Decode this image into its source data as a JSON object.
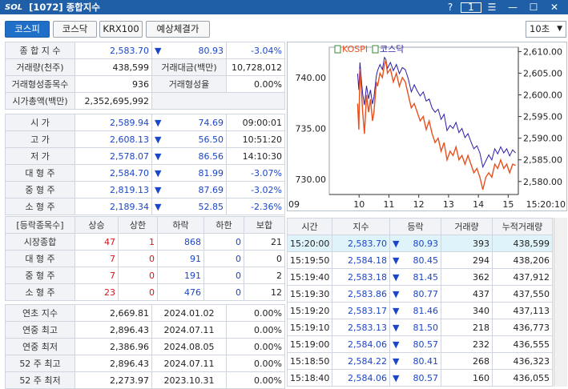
{
  "window": {
    "logo": "SOL",
    "title": "[1072] 종합지수",
    "help": "?",
    "num_box": "1"
  },
  "tabs": [
    "코스피",
    "코스닥",
    "KRX100",
    "예상체결가"
  ],
  "interval": "10초",
  "summary": [
    [
      "종 합 지 수",
      "2,583.70",
      "▼",
      "80.93",
      "-3.04%"
    ],
    [
      "거래량(천주)",
      "438,599",
      "거래대금(백만)",
      "10,728,012"
    ],
    [
      "거래형성종목수",
      "936",
      "거래형성율",
      "0.00%"
    ],
    [
      "시가총액(백만)",
      "2,352,695,992"
    ]
  ],
  "ohlc": [
    {
      "label": "시 가",
      "value": "2,589.94",
      "arrow": "▼",
      "diff": "74.69",
      "extra": "09:00:01"
    },
    {
      "label": "고 가",
      "value": "2,608.13",
      "arrow": "▼",
      "diff": "56.50",
      "extra": "10:51:20"
    },
    {
      "label": "저 가",
      "value": "2,578.07",
      "arrow": "▼",
      "diff": "86.56",
      "extra": "14:10:30"
    },
    {
      "label": "대 형 주",
      "value": "2,584.70",
      "arrow": "▼",
      "diff": "81.99",
      "extra": "-3.07%"
    },
    {
      "label": "중 형 주",
      "value": "2,819.13",
      "arrow": "▼",
      "diff": "87.69",
      "extra": "-3.02%"
    },
    {
      "label": "소 형 주",
      "value": "2,189.34",
      "arrow": "▼",
      "diff": "52.85",
      "extra": "-2.36%"
    }
  ],
  "breadth": {
    "headers": [
      "[등락종목수]",
      "상승",
      "상한",
      "하락",
      "하한",
      "보합"
    ],
    "rows": [
      [
        "시장종합",
        "47",
        "1",
        "868",
        "0",
        "21"
      ],
      [
        "대 형 주",
        "7",
        "0",
        "91",
        "0",
        "0"
      ],
      [
        "중 형 주",
        "7",
        "0",
        "191",
        "0",
        "2"
      ],
      [
        "소 형 주",
        "23",
        "0",
        "476",
        "0",
        "12"
      ]
    ]
  },
  "yearly": [
    [
      "연초 지수",
      "2,669.81",
      "2024.01.02",
      "0.00%"
    ],
    [
      "연중 최고",
      "2,896.43",
      "2024.07.11",
      "0.00%"
    ],
    [
      "연중 최저",
      "2,386.96",
      "2024.08.05",
      "0.00%"
    ],
    [
      "52 주 최고",
      "2,896.43",
      "2024.07.11",
      "0.00%"
    ],
    [
      "52 주 최저",
      "2,273.97",
      "2023.10.31",
      "0.00%"
    ]
  ],
  "ticks": {
    "headers": [
      "시간",
      "지수",
      "등락",
      "거래량",
      "누적거래량"
    ],
    "rows": [
      [
        "15:20:00",
        "2,583.70",
        "▼",
        "80.93",
        "393",
        "438,599"
      ],
      [
        "15:19:50",
        "2,584.18",
        "▼",
        "80.45",
        "294",
        "438,206"
      ],
      [
        "15:19:40",
        "2,583.18",
        "▼",
        "81.45",
        "362",
        "437,912"
      ],
      [
        "15:19:30",
        "2,583.86",
        "▼",
        "80.77",
        "437",
        "437,550"
      ],
      [
        "15:19:20",
        "2,583.17",
        "▼",
        "81.46",
        "340",
        "437,113"
      ],
      [
        "15:19:10",
        "2,583.13",
        "▼",
        "81.50",
        "218",
        "436,773"
      ],
      [
        "15:19:00",
        "2,584.06",
        "▼",
        "80.57",
        "232",
        "436,555"
      ],
      [
        "15:18:50",
        "2,584.22",
        "▼",
        "80.41",
        "268",
        "436,323"
      ],
      [
        "15:18:40",
        "2,584.06",
        "▼",
        "80.57",
        "160",
        "436,055"
      ]
    ]
  },
  "chart_data": {
    "type": "line",
    "legend": [
      "KOSPI",
      "코스닥"
    ],
    "x_ticks": [
      "09",
      "10",
      "11",
      "12",
      "13",
      "14",
      "15",
      "15:20:10"
    ],
    "left_ticks": [
      "740.00",
      "735.00",
      "730.00"
    ],
    "right_ticks": [
      "2,610.00",
      "2,605.00",
      "2,600.00",
      "2,595.00",
      "2,590.00",
      "2,585.00",
      "2,580.00"
    ],
    "ylim_left": [
      728.5,
      743
    ],
    "ylim_right": [
      2577,
      2611
    ],
    "xlim": [
      9,
      15.34
    ],
    "colors": {
      "kospi": "#e8501e",
      "kosdaq": "#2b1ea8"
    },
    "kospi": [
      [
        9.95,
        2598
      ],
      [
        9.99,
        2592
      ],
      [
        10.03,
        2606
      ],
      [
        10.08,
        2601
      ],
      [
        10.12,
        2596
      ],
      [
        10.18,
        2591
      ],
      [
        10.25,
        2600
      ],
      [
        10.32,
        2596
      ],
      [
        10.38,
        2599
      ],
      [
        10.45,
        2594
      ],
      [
        10.5,
        2596
      ],
      [
        10.58,
        2603
      ],
      [
        10.62,
        2602
      ],
      [
        10.7,
        2605
      ],
      [
        10.78,
        2604
      ],
      [
        10.85,
        2607
      ],
      [
        10.9,
        2608
      ],
      [
        10.95,
        2605
      ],
      [
        11.05,
        2606
      ],
      [
        11.15,
        2603
      ],
      [
        11.25,
        2605
      ],
      [
        11.35,
        2602
      ],
      [
        11.45,
        2604
      ],
      [
        11.55,
        2603
      ],
      [
        11.65,
        2600
      ],
      [
        11.75,
        2597
      ],
      [
        11.85,
        2598
      ],
      [
        11.95,
        2596
      ],
      [
        12.05,
        2594
      ],
      [
        12.15,
        2595
      ],
      [
        12.25,
        2592
      ],
      [
        12.35,
        2594
      ],
      [
        12.45,
        2591
      ],
      [
        12.55,
        2589
      ],
      [
        12.65,
        2590
      ],
      [
        12.75,
        2587
      ],
      [
        12.85,
        2589
      ],
      [
        12.95,
        2585
      ],
      [
        13.05,
        2587
      ],
      [
        13.15,
        2586
      ],
      [
        13.25,
        2588
      ],
      [
        13.35,
        2585
      ],
      [
        13.45,
        2586
      ],
      [
        13.55,
        2584
      ],
      [
        13.65,
        2586
      ],
      [
        13.75,
        2584
      ],
      [
        13.85,
        2582
      ],
      [
        13.95,
        2583
      ],
      [
        14.05,
        2581
      ],
      [
        14.15,
        2578.1
      ],
      [
        14.25,
        2581
      ],
      [
        14.35,
        2582
      ],
      [
        14.45,
        2581
      ],
      [
        14.55,
        2584
      ],
      [
        14.65,
        2583
      ],
      [
        14.75,
        2585
      ],
      [
        14.85,
        2583
      ],
      [
        14.95,
        2584
      ],
      [
        15.05,
        2582
      ],
      [
        15.15,
        2584
      ],
      [
        15.25,
        2583.7
      ]
    ],
    "kosdaq": [
      [
        9.95,
        740.4
      ],
      [
        9.99,
        738.8
      ],
      [
        10.03,
        741.5
      ],
      [
        10.08,
        739.7
      ],
      [
        10.12,
        738.4
      ],
      [
        10.18,
        737.3
      ],
      [
        10.25,
        739.2
      ],
      [
        10.32,
        737.9
      ],
      [
        10.38,
        738.8
      ],
      [
        10.45,
        737.4
      ],
      [
        10.5,
        738.1
      ],
      [
        10.58,
        740.2
      ],
      [
        10.62,
        740.7
      ],
      [
        10.7,
        741.3
      ],
      [
        10.78,
        740.8
      ],
      [
        10.85,
        742.0
      ],
      [
        10.9,
        741.8
      ],
      [
        10.95,
        740.9
      ],
      [
        11.05,
        741.5
      ],
      [
        11.15,
        740.7
      ],
      [
        11.25,
        741.3
      ],
      [
        11.35,
        740.4
      ],
      [
        11.45,
        741.0
      ],
      [
        11.55,
        740.8
      ],
      [
        11.65,
        739.9
      ],
      [
        11.75,
        738.6
      ],
      [
        11.85,
        739.3
      ],
      [
        11.95,
        738.7
      ],
      [
        12.05,
        738.2
      ],
      [
        12.15,
        738.6
      ],
      [
        12.25,
        737.7
      ],
      [
        12.35,
        737.9
      ],
      [
        12.45,
        737.0
      ],
      [
        12.55,
        736.6
      ],
      [
        12.65,
        736.9
      ],
      [
        12.75,
        735.9
      ],
      [
        12.85,
        736.4
      ],
      [
        12.95,
        734.8
      ],
      [
        13.05,
        735.3
      ],
      [
        13.15,
        735.0
      ],
      [
        13.25,
        735.6
      ],
      [
        13.35,
        734.6
      ],
      [
        13.45,
        735.0
      ],
      [
        13.55,
        734.1
      ],
      [
        13.65,
        734.5
      ],
      [
        13.75,
        733.7
      ],
      [
        13.85,
        733.0
      ],
      [
        13.95,
        733.3
      ],
      [
        14.05,
        732.6
      ],
      [
        14.15,
        731.2
      ],
      [
        14.25,
        731.8
      ],
      [
        14.35,
        732.4
      ],
      [
        14.45,
        731.9
      ],
      [
        14.55,
        733.0
      ],
      [
        14.65,
        732.5
      ],
      [
        14.75,
        733.2
      ],
      [
        14.85,
        732.6
      ],
      [
        14.95,
        733.0
      ],
      [
        15.05,
        732.3
      ],
      [
        15.15,
        732.9
      ],
      [
        15.25,
        732.6
      ]
    ]
  }
}
